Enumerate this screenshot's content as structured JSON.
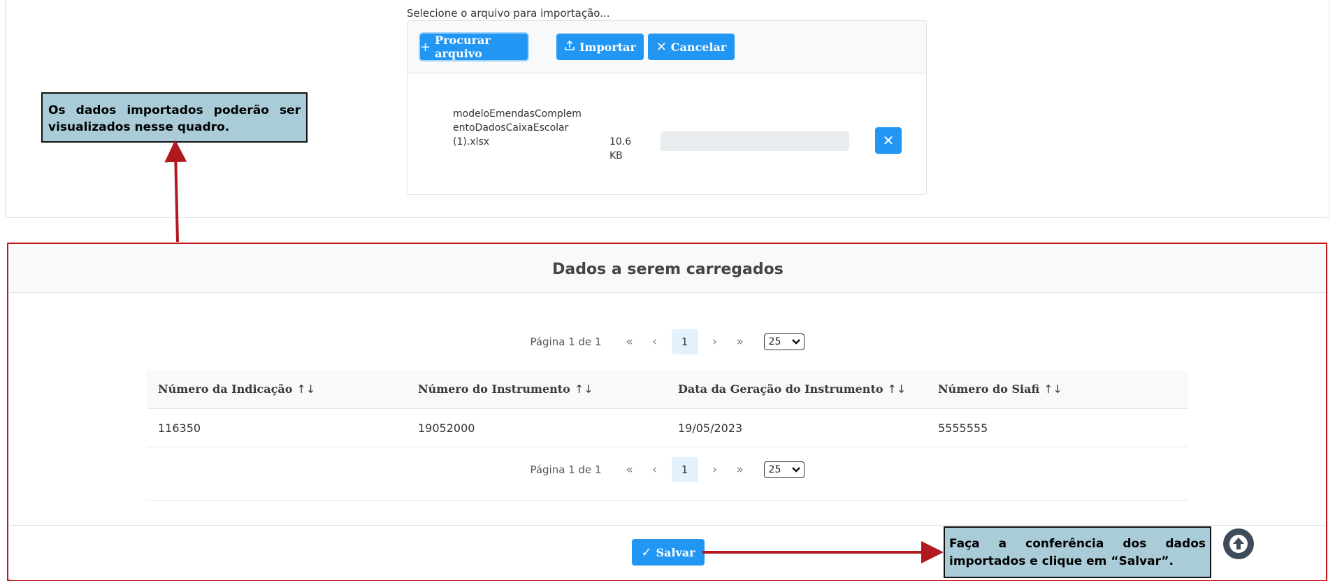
{
  "upload": {
    "label": "Selecione o arquivo para importação...",
    "buttons": {
      "browse": "Procurar arquivo",
      "import": "Importar",
      "cancel": "Cancelar"
    },
    "file": {
      "name": "modeloEmendasComplementoDadosCaixaEscolar (1).xlsx",
      "size": "10.6 KB"
    }
  },
  "callouts": {
    "top": "Os dados importados poderão ser visualizados nesse quadro.",
    "bottom": "Faça a conferência dos dados importados e clique em “Salvar”."
  },
  "data_panel": {
    "title": "Dados a serem carregados",
    "paginator": {
      "info": "Página 1 de 1",
      "current_page": "1",
      "rows_per_page": "25"
    },
    "table": {
      "columns": [
        "Número da Indicação",
        "Número do Instrumento",
        "Data da Geração do Instrumento",
        "Número do Siafi"
      ],
      "rows": [
        [
          "116350",
          "19052000",
          "19/05/2023",
          "5555555"
        ]
      ]
    },
    "save_label": "Salvar"
  },
  "icons": {
    "plus": "plus-icon",
    "upload": "upload-icon",
    "times": "times-icon",
    "check": "check-icon",
    "sort": "sort-icon",
    "scroll_top": "arrow-up-circle-icon"
  },
  "colors": {
    "primary": "#2196f3",
    "annotation_border": "#c4161c",
    "callout_bg": "#a9ccd8"
  }
}
